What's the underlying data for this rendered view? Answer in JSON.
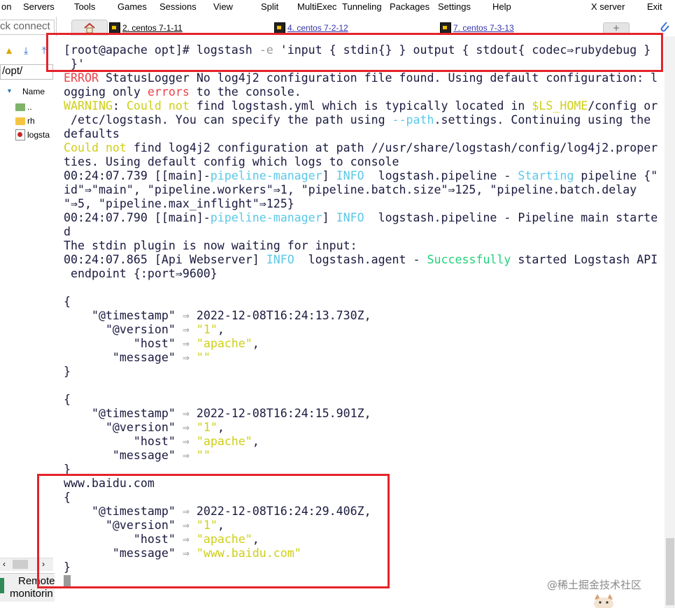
{
  "menubar": {
    "items": [
      "on",
      "Servers",
      "Tools",
      "Games",
      "Sessions",
      "View",
      "Split",
      "MultiExec",
      "Tunneling",
      "Packages",
      "Settings",
      "Help",
      "X server",
      "Exit"
    ]
  },
  "tabs": [
    {
      "label": "2. centos 7-1-11",
      "icon": "terminal-icon",
      "active": true
    },
    {
      "label": "4. centos 7-2-12",
      "icon": "terminal-icon",
      "active": false
    },
    {
      "label": "7. centos 7-3-13",
      "icon": "terminal-icon",
      "active": false
    }
  ],
  "sidebar": {
    "quick_connect": "ck connect",
    "path": "/opt/",
    "name_header": "Name",
    "files": [
      {
        "name": "..",
        "icon": "up-folder-icon"
      },
      {
        "name": "rh",
        "icon": "folder-icon"
      },
      {
        "name": "logsta",
        "icon": "file-icon"
      }
    ],
    "remote_label_1": "Remote",
    "remote_label_2": "monitorin"
  },
  "terminal": {
    "lines": [
      [
        {
          "t": "[root@apache opt]# logstash ",
          "c": ""
        },
        {
          "t": "-e",
          "c": "gray"
        },
        {
          "t": " 'input { stdin{} } output { stdout{ codec⇒rubydebug }",
          "c": ""
        }
      ],
      [
        {
          "t": " }'",
          "c": ""
        }
      ],
      [
        {
          "t": "ERROR",
          "c": "red"
        },
        {
          "t": " StatusLogger No log4j2 configuration file found. Using default configuration: l",
          "c": ""
        }
      ],
      [
        {
          "t": "ogging only ",
          "c": ""
        },
        {
          "t": "errors",
          "c": "red"
        },
        {
          "t": " to the console.",
          "c": ""
        }
      ],
      [
        {
          "t": "WARNING",
          "c": "yellow"
        },
        {
          "t": ": ",
          "c": ""
        },
        {
          "t": "Could not",
          "c": "yellow"
        },
        {
          "t": " find logstash.yml which is typically located in ",
          "c": ""
        },
        {
          "t": "$LS_HOME",
          "c": "yellow"
        },
        {
          "t": "/config or",
          "c": ""
        }
      ],
      [
        {
          "t": " /etc/logstash. You can specify the path using ",
          "c": ""
        },
        {
          "t": "--path",
          "c": "cyan"
        },
        {
          "t": ".settings. Continuing using the",
          "c": ""
        }
      ],
      [
        {
          "t": "defaults",
          "c": ""
        }
      ],
      [
        {
          "t": "Could not",
          "c": "yellow"
        },
        {
          "t": " find log4j2 configuration at path //usr/share/logstash/config/log4j2.proper",
          "c": ""
        }
      ],
      [
        {
          "t": "ties. Using default config which logs to console",
          "c": ""
        }
      ],
      [
        {
          "t": "00:24:07.739 [[main]-",
          "c": ""
        },
        {
          "t": "pipeline-manager",
          "c": "cyan"
        },
        {
          "t": "] ",
          "c": ""
        },
        {
          "t": "INFO",
          "c": "cyan"
        },
        {
          "t": "  logstash.pipeline - ",
          "c": ""
        },
        {
          "t": "Starting",
          "c": "cyan"
        },
        {
          "t": " pipeline {\"",
          "c": ""
        }
      ],
      [
        {
          "t": "id\"⇒\"main\", \"pipeline.workers\"⇒1, \"pipeline.batch.size\"⇒125, \"pipeline.batch.delay",
          "c": ""
        }
      ],
      [
        {
          "t": "\"⇒5, \"pipeline.max_inflight\"⇒125}",
          "c": ""
        }
      ],
      [
        {
          "t": "00:24:07.790 [[main]-",
          "c": ""
        },
        {
          "t": "pipeline-manager",
          "c": "cyan"
        },
        {
          "t": "] ",
          "c": ""
        },
        {
          "t": "INFO",
          "c": "cyan"
        },
        {
          "t": "  logstash.pipeline - Pipeline main starte",
          "c": ""
        }
      ],
      [
        {
          "t": "d",
          "c": ""
        }
      ],
      [
        {
          "t": "The stdin plugin is now waiting for input:",
          "c": ""
        }
      ],
      [
        {
          "t": "00:24:07.865 [Api Webserver] ",
          "c": ""
        },
        {
          "t": "INFO",
          "c": "cyan"
        },
        {
          "t": "  logstash.agent - ",
          "c": ""
        },
        {
          "t": "Successfully",
          "c": "green"
        },
        {
          "t": " started Logstash API",
          "c": ""
        }
      ],
      [
        {
          "t": " endpoint {:port⇒9600}",
          "c": ""
        }
      ],
      [
        {
          "t": "",
          "c": ""
        }
      ],
      [
        {
          "t": "{",
          "c": ""
        }
      ],
      [
        {
          "t": "    \"@timestamp\" ",
          "c": ""
        },
        {
          "t": "⇒",
          "c": "gray"
        },
        {
          "t": " 2022-12-08T16:24:13.730Z,",
          "c": ""
        }
      ],
      [
        {
          "t": "      \"@version\" ",
          "c": ""
        },
        {
          "t": "⇒",
          "c": "gray"
        },
        {
          "t": " ",
          "c": ""
        },
        {
          "t": "\"1\"",
          "c": "yellow"
        },
        {
          "t": ",",
          "c": ""
        }
      ],
      [
        {
          "t": "          \"host\" ",
          "c": ""
        },
        {
          "t": "⇒",
          "c": "gray"
        },
        {
          "t": " ",
          "c": ""
        },
        {
          "t": "\"apache\"",
          "c": "yellow"
        },
        {
          "t": ",",
          "c": ""
        }
      ],
      [
        {
          "t": "       \"message\" ",
          "c": ""
        },
        {
          "t": "⇒",
          "c": "gray"
        },
        {
          "t": " ",
          "c": ""
        },
        {
          "t": "\"\"",
          "c": "yellow"
        }
      ],
      [
        {
          "t": "}",
          "c": ""
        }
      ],
      [
        {
          "t": "",
          "c": ""
        }
      ],
      [
        {
          "t": "{",
          "c": ""
        }
      ],
      [
        {
          "t": "    \"@timestamp\" ",
          "c": ""
        },
        {
          "t": "⇒",
          "c": "gray"
        },
        {
          "t": " 2022-12-08T16:24:15.901Z,",
          "c": ""
        }
      ],
      [
        {
          "t": "      \"@version\" ",
          "c": ""
        },
        {
          "t": "⇒",
          "c": "gray"
        },
        {
          "t": " ",
          "c": ""
        },
        {
          "t": "\"1\"",
          "c": "yellow"
        },
        {
          "t": ",",
          "c": ""
        }
      ],
      [
        {
          "t": "          \"host\" ",
          "c": ""
        },
        {
          "t": "⇒",
          "c": "gray"
        },
        {
          "t": " ",
          "c": ""
        },
        {
          "t": "\"apache\"",
          "c": "yellow"
        },
        {
          "t": ",",
          "c": ""
        }
      ],
      [
        {
          "t": "       \"message\" ",
          "c": ""
        },
        {
          "t": "⇒",
          "c": "gray"
        },
        {
          "t": " ",
          "c": ""
        },
        {
          "t": "\"\"",
          "c": "yellow"
        }
      ],
      [
        {
          "t": "}",
          "c": ""
        }
      ],
      [
        {
          "t": "www.baidu.com",
          "c": ""
        }
      ],
      [
        {
          "t": "{",
          "c": ""
        }
      ],
      [
        {
          "t": "    \"@timestamp\" ",
          "c": ""
        },
        {
          "t": "⇒",
          "c": "gray"
        },
        {
          "t": " 2022-12-08T16:24:29.406Z,",
          "c": ""
        }
      ],
      [
        {
          "t": "      \"@version\" ",
          "c": ""
        },
        {
          "t": "⇒",
          "c": "gray"
        },
        {
          "t": " ",
          "c": ""
        },
        {
          "t": "\"1\"",
          "c": "yellow"
        },
        {
          "t": ",",
          "c": ""
        }
      ],
      [
        {
          "t": "          \"host\" ",
          "c": ""
        },
        {
          "t": "⇒",
          "c": "gray"
        },
        {
          "t": " ",
          "c": ""
        },
        {
          "t": "\"apache\"",
          "c": "yellow"
        },
        {
          "t": ",",
          "c": ""
        }
      ],
      [
        {
          "t": "       \"message\" ",
          "c": ""
        },
        {
          "t": "⇒",
          "c": "gray"
        },
        {
          "t": " ",
          "c": ""
        },
        {
          "t": "\"www.baidu.com\"",
          "c": "yellow"
        }
      ],
      [
        {
          "t": "}",
          "c": ""
        }
      ]
    ]
  },
  "watermark": "@稀土掘金技术社区",
  "colors": {
    "annotation": "#e5232a",
    "terminal_text": "#1a1a40",
    "error": "#e8434a",
    "warning": "#cfcf17",
    "info": "#5ac8e8",
    "success": "#22d27a"
  }
}
